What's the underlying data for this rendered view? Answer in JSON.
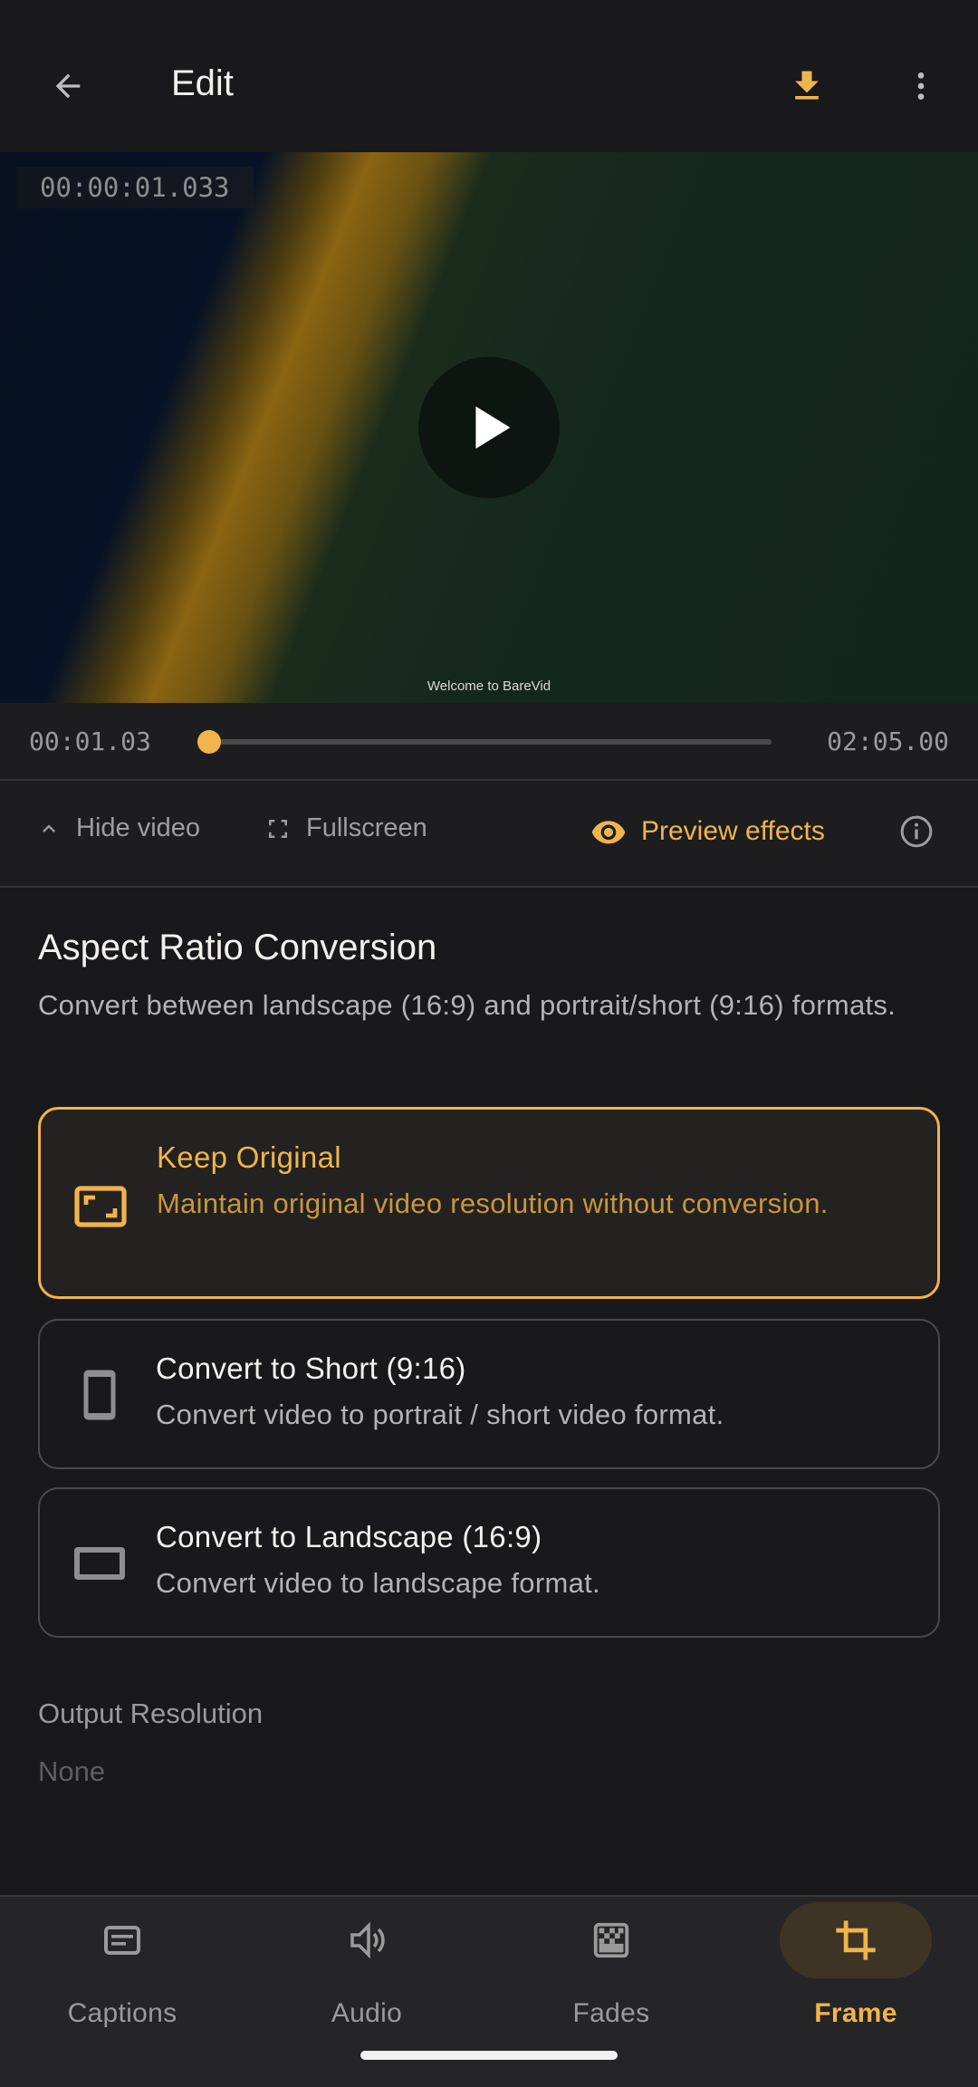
{
  "appbar": {
    "title": "Edit"
  },
  "video": {
    "timecode": "00:00:01.033",
    "subtitle": "Welcome to BareVid"
  },
  "scrubber": {
    "current": "00:01.03",
    "duration": "02:05.00",
    "progress": 0.008
  },
  "tools": {
    "hide_video": "Hide video",
    "fullscreen": "Fullscreen",
    "preview_effects": "Preview effects"
  },
  "section": {
    "title": "Aspect Ratio Conversion",
    "description": "Convert between landscape (16:9) and portrait/short (9:16) formats."
  },
  "options": [
    {
      "title": "Keep Original",
      "description": "Maintain original video resolution without conversion.",
      "selected": true,
      "icon": "aspect-ratio-icon"
    },
    {
      "title": "Convert to Short (9:16)",
      "description": "Convert video to portrait / short video format.",
      "selected": false,
      "icon": "phone-portrait-icon"
    },
    {
      "title": "Convert to Landscape (16:9)",
      "description": "Convert video to landscape format.",
      "selected": false,
      "icon": "landscape-icon"
    }
  ],
  "output": {
    "label": "Output Resolution",
    "value": "None"
  },
  "nav": [
    {
      "label": "Captions",
      "icon": "captions-icon",
      "active": false
    },
    {
      "label": "Audio",
      "icon": "audio-icon",
      "active": false
    },
    {
      "label": "Fades",
      "icon": "fades-icon",
      "active": false
    },
    {
      "label": "Frame",
      "icon": "crop-icon",
      "active": true
    }
  ],
  "colors": {
    "accent": "#f0b44c",
    "background": "#19191b",
    "surface": "#252527"
  }
}
